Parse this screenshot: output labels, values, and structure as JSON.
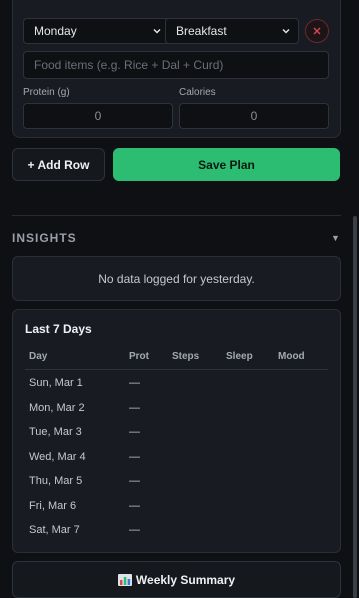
{
  "plan": {
    "day_select": "Monday",
    "meal_select": "Breakfast",
    "food_placeholder": "Food items (e.g. Rice + Dal + Curd)",
    "protein_label": "Protein (g)",
    "protein_value": "0",
    "calories_label": "Calories",
    "calories_value": "0"
  },
  "actions": {
    "add_row_label": "+ Add Row",
    "save_label": "Save Plan"
  },
  "insights": {
    "title": "INSIGHTS",
    "chevron": "▼",
    "yesterday_text": "No data logged for yesterday."
  },
  "week": {
    "title": "Last 7 Days",
    "headers": {
      "day": "Day",
      "prot": "Prot",
      "steps": "Steps",
      "sleep": "Sleep",
      "mood": "Mood"
    },
    "rows": [
      {
        "day": "Sun, Mar 1",
        "prot": "—"
      },
      {
        "day": "Mon, Mar 2",
        "prot": "—"
      },
      {
        "day": "Tue, Mar 3",
        "prot": "—"
      },
      {
        "day": "Wed, Mar 4",
        "prot": "—"
      },
      {
        "day": "Thu, Mar 5",
        "prot": "—"
      },
      {
        "day": "Fri, Mar 6",
        "prot": "—"
      },
      {
        "day": "Sat, Mar 7",
        "prot": "—"
      }
    ]
  },
  "summary": {
    "icon": "bar-chart-icon",
    "label": "Weekly Summary"
  },
  "colors": {
    "accent": "#2dbd72",
    "danger": "#d9484f",
    "background": "#0e1014",
    "card": "#181b21"
  }
}
